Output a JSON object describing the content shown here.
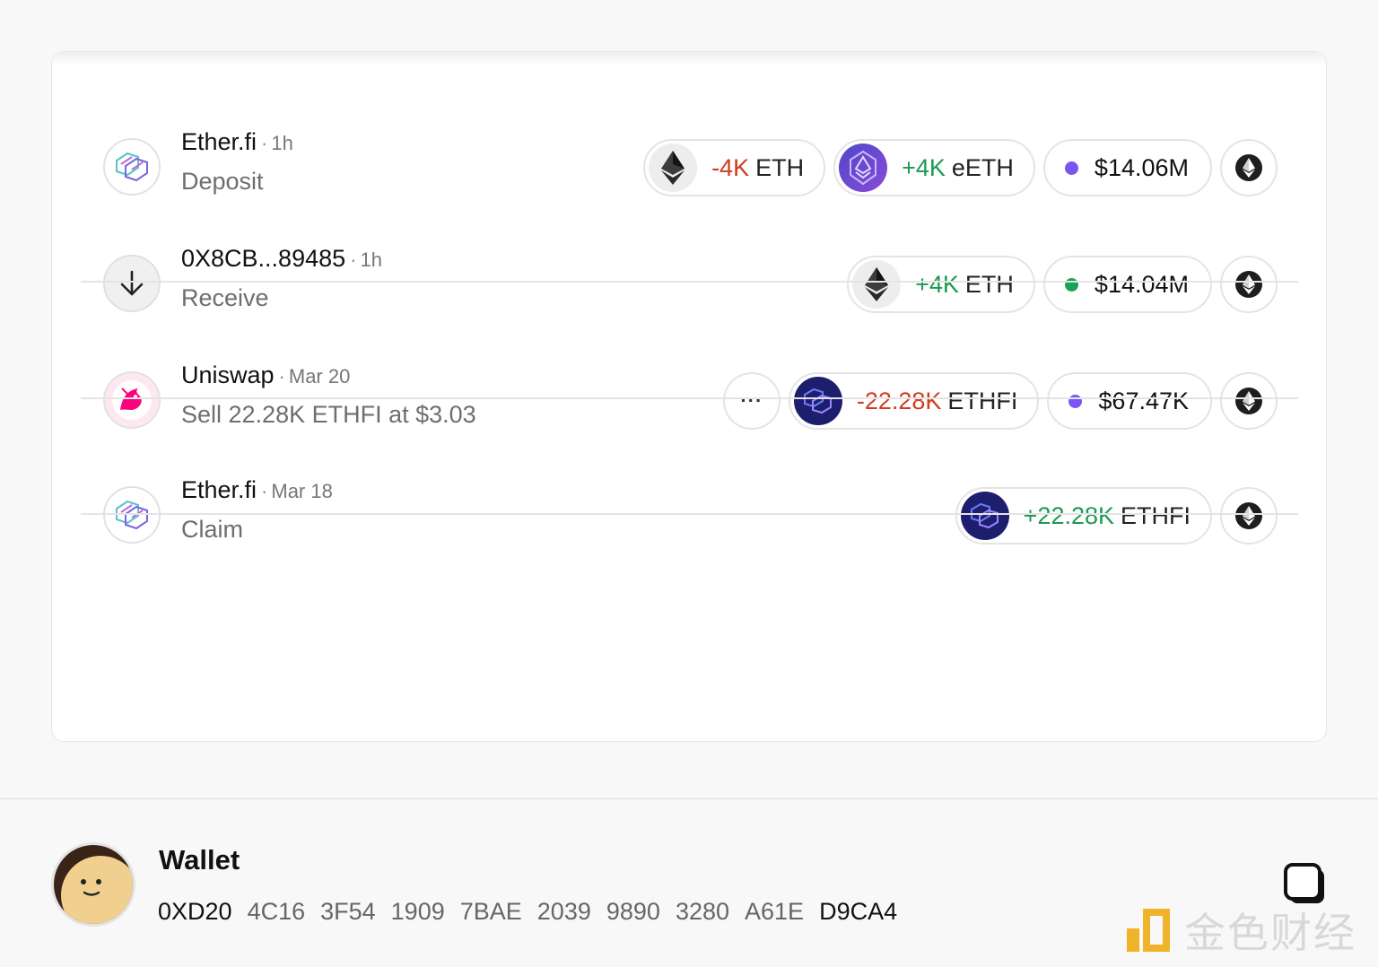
{
  "transactions": [
    {
      "name": "Ether.fi",
      "separator": "·",
      "time": "1h",
      "action": "Deposit",
      "avatar": "etherfi-logo",
      "has_more": false,
      "tokens": [
        {
          "amount": "-4K",
          "symbol": "ETH",
          "sign": "neg",
          "icon": "eth-icon"
        },
        {
          "amount": "+4K",
          "symbol": "eETH",
          "sign": "pos",
          "icon": "eeth-icon"
        }
      ],
      "value": {
        "text": "$14.06M",
        "dot_color": "#7a55f3"
      },
      "chain_icon": "ethereum-chain-icon"
    },
    {
      "name": "0X8CB...89485",
      "separator": "·",
      "time": "1h",
      "action": "Receive",
      "avatar": "arrow-down-icon",
      "has_more": false,
      "tokens": [
        {
          "amount": "+4K",
          "symbol": "ETH",
          "sign": "pos",
          "icon": "eth-icon"
        }
      ],
      "value": {
        "text": "$14.04M",
        "dot_color": "#1aa257"
      },
      "chain_icon": "ethereum-chain-icon"
    },
    {
      "name": "Uniswap",
      "separator": "·",
      "time": "Mar 20",
      "action": "Sell 22.28K ETHFI at $3.03",
      "avatar": "uniswap-logo",
      "has_more": true,
      "more_label": "···",
      "tokens": [
        {
          "amount": "-22.28K",
          "symbol": "ETHFI",
          "sign": "neg",
          "icon": "ethfi-icon"
        }
      ],
      "value": {
        "text": "$67.47K",
        "dot_color": "#7a55f3"
      },
      "chain_icon": "ethereum-chain-icon"
    },
    {
      "name": "Ether.fi",
      "separator": "·",
      "time": "Mar 18",
      "action": "Claim",
      "avatar": "etherfi-logo",
      "has_more": false,
      "tokens": [
        {
          "amount": "+22.28K",
          "symbol": "ETHFI",
          "sign": "pos",
          "icon": "ethfi-icon"
        }
      ],
      "value": null,
      "chain_icon": "ethereum-chain-icon"
    }
  ],
  "wallet": {
    "title": "Wallet",
    "address_groups": [
      "0XD20",
      "4C16",
      "3F54",
      "1909",
      "7BAE",
      "2039",
      "9890",
      "3280",
      "A61E",
      "D9CA4"
    ],
    "copy_icon": "copy-icon",
    "avatar_color": "#f1d08f"
  },
  "watermark": {
    "text": "金色财经",
    "logo_color": "#f0b42a"
  }
}
